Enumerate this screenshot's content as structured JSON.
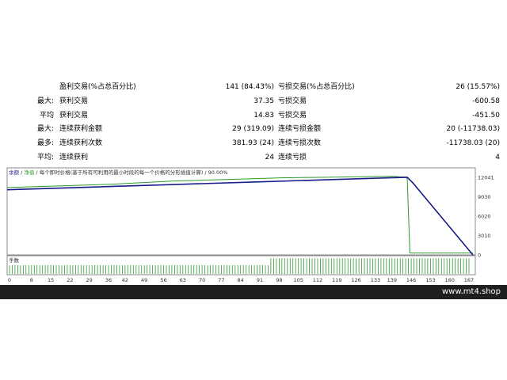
{
  "stats": {
    "rows": [
      {
        "prefix": "",
        "label1": "盈利交易(%占总百分比)",
        "value1": "141 (84.43%)",
        "label2": "亏损交易(%占总百分比)",
        "value2": "26 (15.57%)"
      },
      {
        "prefix": "最大:",
        "label1": "获利交易",
        "value1": "37.35",
        "label2": "亏损交易",
        "value2": "-600.58"
      },
      {
        "prefix": "平均",
        "label1": "获利交易",
        "value1": "14.83",
        "label2": "亏损交易",
        "value2": "-451.50"
      },
      {
        "prefix": "最大:",
        "label1": "连续获利金额",
        "value1": "29 (319.09)",
        "label2": "连续亏损金额",
        "value2": "20 (-11738.03)"
      },
      {
        "prefix": "最多:",
        "label1": "连续获利次数",
        "value1": "381.93 (24)",
        "label2": "连续亏损次数",
        "value2": "-11738.03 (20)"
      },
      {
        "prefix": "平均:",
        "label1": "连续获利",
        "value1": "24",
        "label2": "连续亏损",
        "value2": "4"
      }
    ]
  },
  "chart": {
    "legend": {
      "balance_label": "余额",
      "equity_label": "净值",
      "description": "每个即时价格(基于所有可利用的最小时段的每一个价格的分形插值计算)",
      "quality": "90.00%",
      "balance_color": "#1a1a8c",
      "equity_color": "#2e9b2e"
    },
    "lot_label": "手数",
    "y_ticks": [
      "12041",
      "9030",
      "6020",
      "3010",
      "0"
    ],
    "x_ticks": [
      "0",
      "8",
      "15",
      "22",
      "29",
      "36",
      "42",
      "49",
      "56",
      "63",
      "70",
      "77",
      "84",
      "91",
      "98",
      "105",
      "112",
      "119",
      "126",
      "133",
      "139",
      "146",
      "153",
      "160",
      "167"
    ]
  },
  "chart_data": {
    "type": "line",
    "x_range": [
      0,
      170
    ],
    "ylim": [
      0,
      13500
    ],
    "series": [
      {
        "name": "余额",
        "color": "#1a1a8c",
        "x": [
          0,
          30,
          60,
          90,
          120,
          146,
          148,
          170
        ],
        "y": [
          10100,
          10500,
          10900,
          11300,
          11700,
          12041,
          11200,
          0
        ]
      },
      {
        "name": "净值",
        "color": "#2e9b2e",
        "x": [
          0,
          20,
          40,
          60,
          80,
          100,
          120,
          140,
          146,
          147,
          170
        ],
        "y": [
          10450,
          10700,
          11000,
          11450,
          11700,
          11950,
          12050,
          12200,
          12041,
          300,
          300
        ]
      }
    ],
    "lots": {
      "x_range": [
        0,
        167
      ],
      "step_at": 95,
      "low": 0.5,
      "high": 0.9
    }
  },
  "footer": {
    "brand": "www.mt4.shop"
  }
}
